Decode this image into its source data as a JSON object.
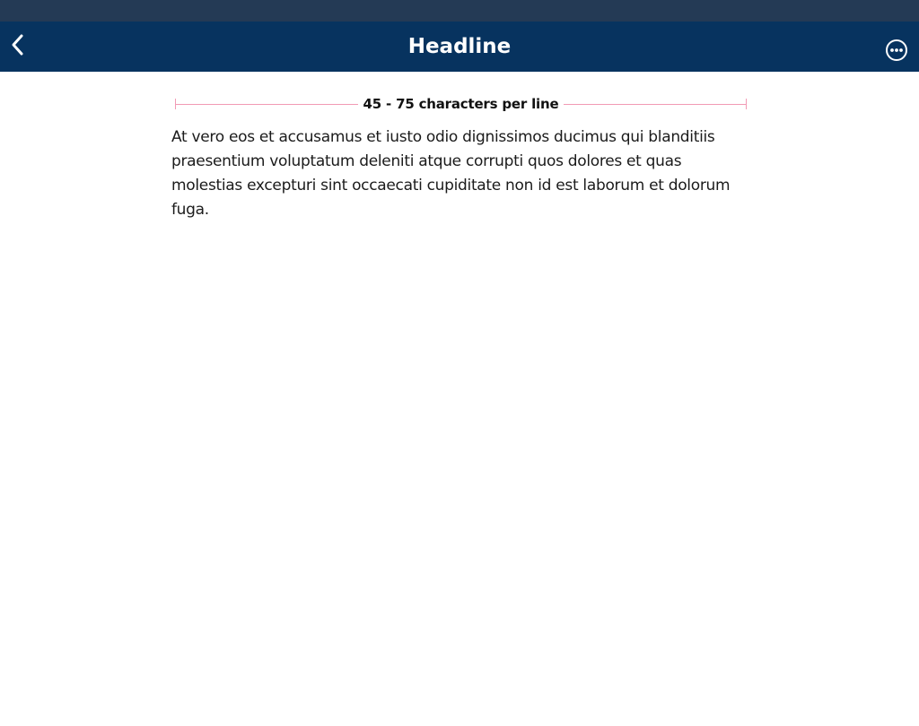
{
  "status_bar": {},
  "nav": {
    "title": "Headline",
    "back_icon": "chevron-left-icon",
    "more_icon": "more-horizontal-circle-icon",
    "background_color": "#07335f",
    "text_color": "#ffffff"
  },
  "measure": {
    "label": "45 - 75 characters per line",
    "line_color": "#f29bb5"
  },
  "content": {
    "paragraph": "At vero eos et accusamus et iusto odio dignissimos ducimus qui blanditiis praesentium voluptatum deleniti atque corrupti quos dolores et quas molestias excepturi sint occaecati cupiditate non id est laborum et dolorum fuga."
  }
}
